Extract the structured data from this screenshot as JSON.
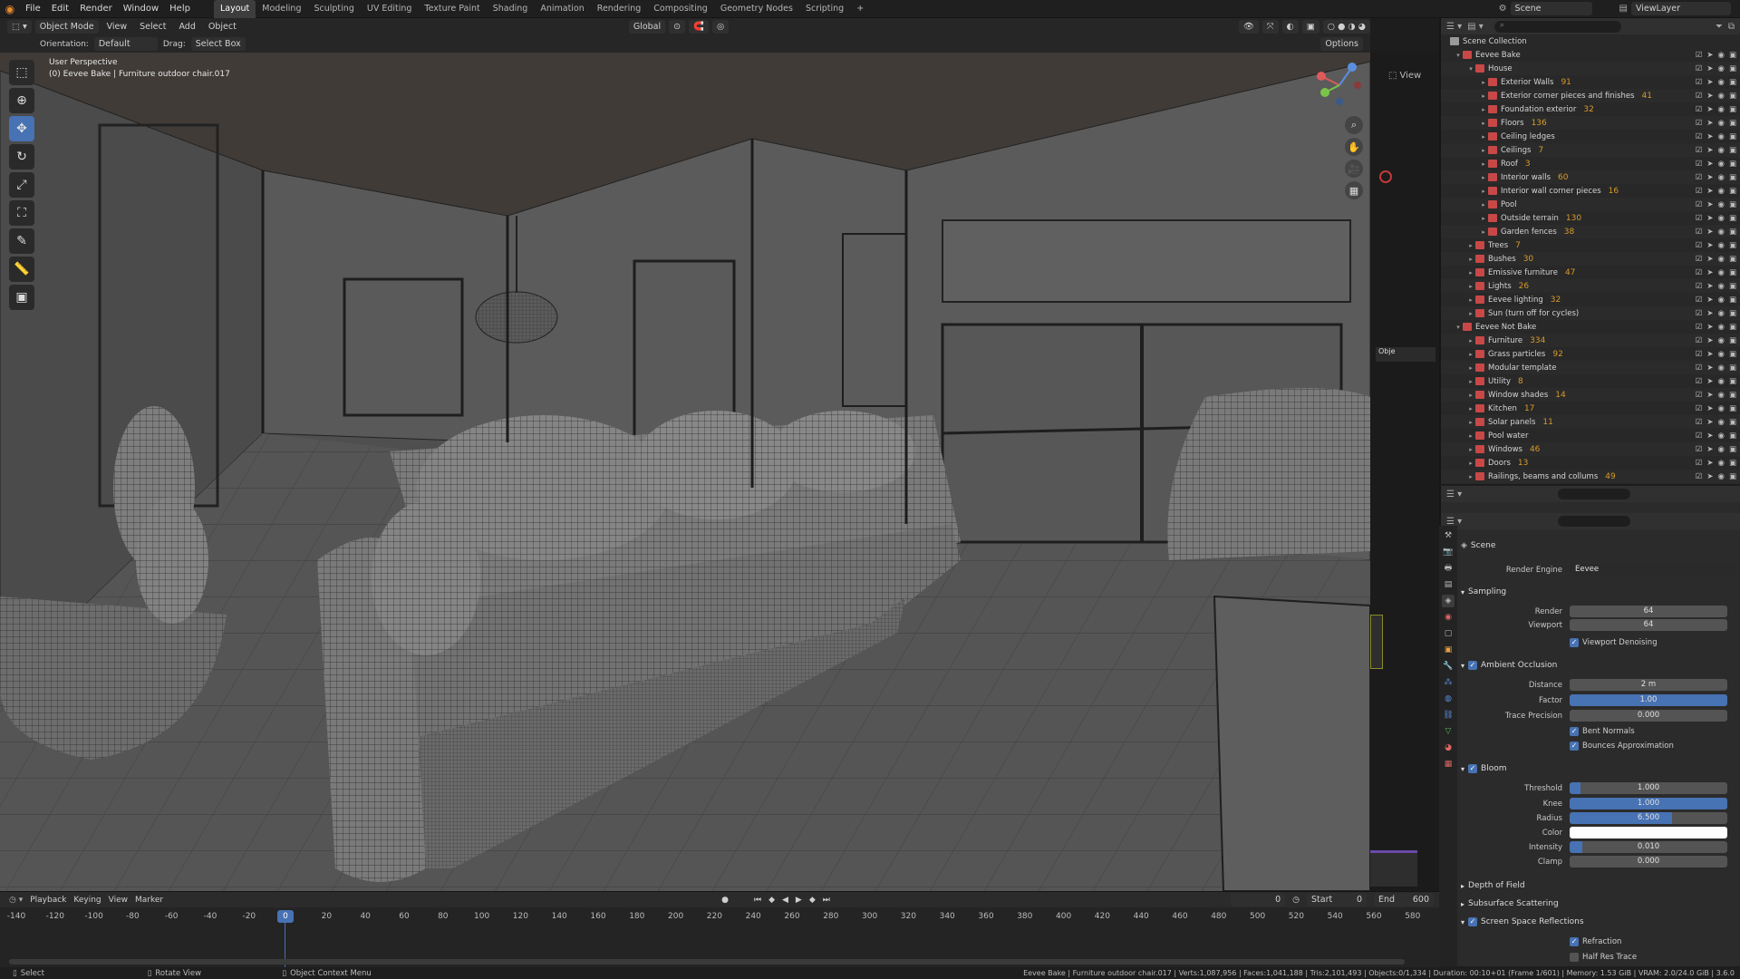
{
  "topbar": {
    "menus": [
      "File",
      "Edit",
      "Render",
      "Window",
      "Help"
    ],
    "workspaces": [
      "Layout",
      "Modeling",
      "Sculpting",
      "UV Editing",
      "Texture Paint",
      "Shading",
      "Animation",
      "Rendering",
      "Compositing",
      "Geometry Nodes",
      "Scripting"
    ],
    "active_workspace": "Layout",
    "scene": "Scene",
    "view_layer": "ViewLayer"
  },
  "header": {
    "mode": "Object Mode",
    "menus": [
      "View",
      "Select",
      "Add",
      "Object"
    ],
    "transform": "Global",
    "view_label": "View"
  },
  "toolheader": {
    "orientation_label": "Orientation:",
    "orientation_value": "Default",
    "drag_label": "Drag:",
    "drag_value": "Select Box",
    "options": "Options"
  },
  "viewport": {
    "perspective": "User Perspective",
    "object": "(0) Eevee Bake | Furniture outdoor chair.017",
    "node_side_label": "Obje"
  },
  "outliner": {
    "root": "Scene Collection",
    "rows": [
      {
        "label": "Eevee Bake",
        "depth": 0,
        "count": ""
      },
      {
        "label": "House",
        "depth": 1,
        "count": ""
      },
      {
        "label": "Exterior Walls",
        "depth": 2,
        "count": "91"
      },
      {
        "label": "Exterior corner pieces and finishes",
        "depth": 2,
        "count": "41"
      },
      {
        "label": "Foundation exterior",
        "depth": 2,
        "count": "32"
      },
      {
        "label": "Floors",
        "depth": 2,
        "count": "136"
      },
      {
        "label": "Ceiling ledges",
        "depth": 2,
        "count": ""
      },
      {
        "label": "Ceilings",
        "depth": 2,
        "count": "7"
      },
      {
        "label": "Roof",
        "depth": 2,
        "count": "3"
      },
      {
        "label": "Interior walls",
        "depth": 2,
        "count": "60"
      },
      {
        "label": "Interior wall corner pieces",
        "depth": 2,
        "count": "16"
      },
      {
        "label": "Pool",
        "depth": 2,
        "count": ""
      },
      {
        "label": "Outside terrain",
        "depth": 2,
        "count": "130"
      },
      {
        "label": "Garden fences",
        "depth": 2,
        "count": "38"
      },
      {
        "label": "Trees",
        "depth": 1,
        "count": "7"
      },
      {
        "label": "Bushes",
        "depth": 1,
        "count": "30"
      },
      {
        "label": "Emissive furniture",
        "depth": 1,
        "count": "47"
      },
      {
        "label": "Lights",
        "depth": 1,
        "count": "26"
      },
      {
        "label": "Eevee lighting",
        "depth": 1,
        "count": "32"
      },
      {
        "label": "Sun (turn off for cycles)",
        "depth": 1,
        "count": ""
      },
      {
        "label": "Eevee Not Bake",
        "depth": 0,
        "count": ""
      },
      {
        "label": "Furniture",
        "depth": 1,
        "count": "334"
      },
      {
        "label": "Grass particles",
        "depth": 1,
        "count": "92"
      },
      {
        "label": "Modular template",
        "depth": 1,
        "count": ""
      },
      {
        "label": "Utility",
        "depth": 1,
        "count": "8"
      },
      {
        "label": "Window shades",
        "depth": 1,
        "count": "14"
      },
      {
        "label": "Kitchen",
        "depth": 1,
        "count": "17"
      },
      {
        "label": "Solar panels",
        "depth": 1,
        "count": "11"
      },
      {
        "label": "Pool water",
        "depth": 1,
        "count": ""
      },
      {
        "label": "Windows",
        "depth": 1,
        "count": "46"
      },
      {
        "label": "Doors",
        "depth": 1,
        "count": "13"
      },
      {
        "label": "Railings, beams and collums",
        "depth": 1,
        "count": "49"
      }
    ]
  },
  "properties": {
    "context": "Scene",
    "render_engine_label": "Render Engine",
    "render_engine": "Eevee",
    "sampling": {
      "title": "Sampling",
      "render_label": "Render",
      "render": "64",
      "viewport_label": "Viewport",
      "viewport": "64",
      "denoise": "Viewport Denoising"
    },
    "ao": {
      "title": "Ambient Occlusion",
      "distance_label": "Distance",
      "distance": "2 m",
      "factor_label": "Factor",
      "factor": "1.00",
      "trace_label": "Trace Precision",
      "trace": "0.000",
      "bent": "Bent Normals",
      "bounces": "Bounces Approximation"
    },
    "bloom": {
      "title": "Bloom",
      "threshold_label": "Threshold",
      "threshold": "1.000",
      "knee_label": "Knee",
      "knee": "1.000",
      "radius_label": "Radius",
      "radius": "6.500",
      "color_label": "Color",
      "intensity_label": "Intensity",
      "intensity": "0.010",
      "clamp_label": "Clamp",
      "clamp": "0.000"
    },
    "dof": "Depth of Field",
    "sss": "Subsurface Scattering",
    "ssr": {
      "title": "Screen Space Reflections",
      "refraction": "Refraction",
      "half_res": "Half Res Trace"
    }
  },
  "timeline": {
    "menus": [
      "Playback",
      "Keying",
      "View",
      "Marker"
    ],
    "current_frame": "0",
    "start_label": "Start",
    "start": "0",
    "end_label": "End",
    "end": "600",
    "playhead": "0",
    "ticks": [
      "-140",
      "-120",
      "-100",
      "-80",
      "-60",
      "-40",
      "-20",
      "0",
      "20",
      "40",
      "60",
      "80",
      "100",
      "120",
      "140",
      "160",
      "180",
      "200",
      "220",
      "240",
      "260",
      "280",
      "300",
      "320",
      "340",
      "360",
      "380",
      "400",
      "420",
      "440",
      "460",
      "480",
      "500",
      "520",
      "540",
      "560",
      "580"
    ]
  },
  "statusbar": {
    "select": "Select",
    "rotate": "Rotate View",
    "context": "Object Context Menu",
    "stats": "Eevee Bake | Furniture outdoor chair.017 | Verts:1,087,956 | Faces:1,041,188 | Tris:2,101,493 | Objects:0/1,334 | Duration: 00:10+01 (Frame 1/601) | Memory: 1.53 GiB | VRAM: 2.0/24.0 GiB | 3.6.0"
  },
  "colors": {
    "accent": "#4772b3",
    "collection": "#c84848",
    "filter": "#d89a2a"
  }
}
